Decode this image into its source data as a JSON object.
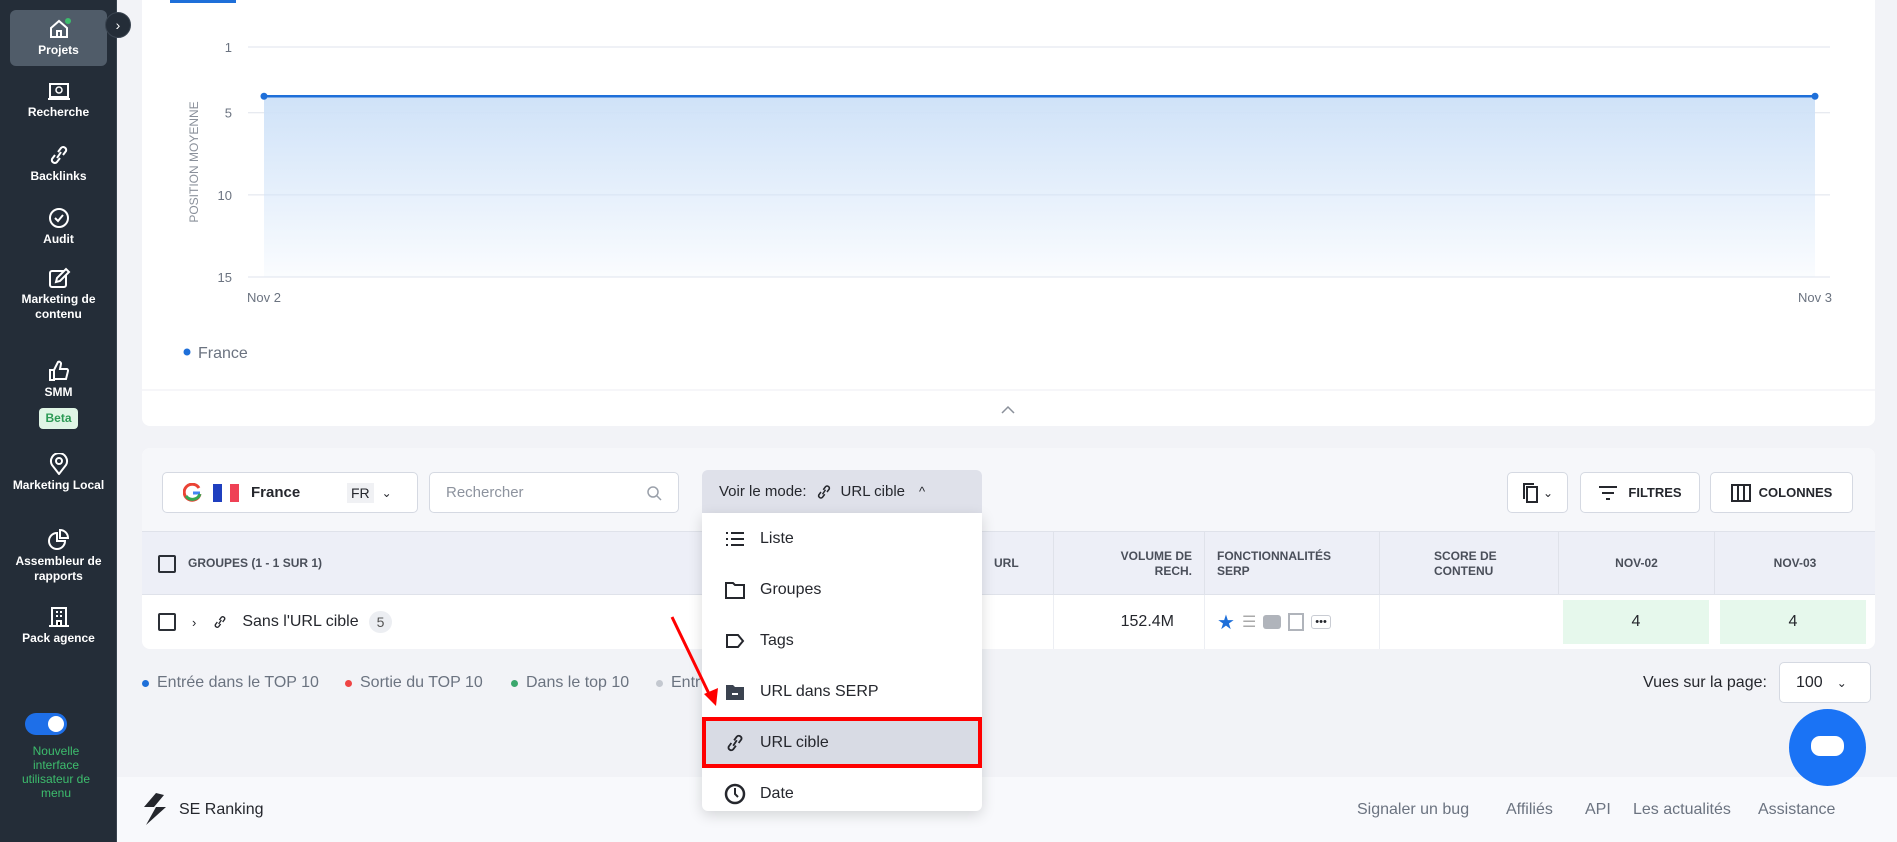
{
  "sidebar": {
    "items": [
      {
        "label": "Projets",
        "icon": "home-icon"
      },
      {
        "label": "Recherche",
        "icon": "search-screen-icon"
      },
      {
        "label": "Backlinks",
        "icon": "link-icon"
      },
      {
        "label": "Audit",
        "icon": "check-circle-icon"
      },
      {
        "label": "Marketing de contenu",
        "icon": "edit-icon"
      },
      {
        "label": "SMM",
        "icon": "thumbs-up-icon",
        "badge": "Beta"
      },
      {
        "label": "Marketing Local",
        "icon": "location-icon"
      },
      {
        "label": "Assembleur de rapports",
        "icon": "pie-chart-icon"
      },
      {
        "label": "Pack agence",
        "icon": "building-icon"
      }
    ],
    "toggle_label": "Nouvelle interface utilisateur de menu",
    "toggle_on": true
  },
  "chart_data": {
    "type": "area",
    "ylabel": "POSITION MOYENNE",
    "yticks": [
      1,
      5,
      10,
      15
    ],
    "ylim": [
      1,
      15
    ],
    "y_reversed": true,
    "xticks": [
      "Nov 2",
      "Nov 3"
    ],
    "series": [
      {
        "name": "France",
        "x": [
          "Nov 2",
          "Nov 3"
        ],
        "values": [
          4,
          4
        ],
        "color": "#1e6fd9"
      }
    ],
    "legend": "bottom-left",
    "grid": true
  },
  "toolbar": {
    "engine": "Google",
    "country": "France",
    "country_code": "FR",
    "search_placeholder": "Rechercher",
    "mode_label": "Voir le mode:",
    "mode_value": "URL cible",
    "filters": "FILTRES",
    "columns": "COLONNES"
  },
  "menu": {
    "items": [
      {
        "label": "Liste"
      },
      {
        "label": "Groupes"
      },
      {
        "label": "Tags"
      },
      {
        "label": "URL dans SERP"
      },
      {
        "label": "URL cible",
        "selected": true
      },
      {
        "label": "Date"
      }
    ]
  },
  "table": {
    "headers": {
      "groups": "GROUPES (1 - 1 SUR 1)",
      "url": "URL",
      "volume": "VOLUME DE RECH.",
      "serp": "FONCTIONNALITÉS SERP",
      "score": "SCORE DE CONTENU",
      "nov02": "NOV-02",
      "nov03": "NOV-03"
    },
    "row": {
      "name": "Sans l'URL cible",
      "count": "5",
      "volume": "152.4M",
      "nov02": "4",
      "nov03": "4"
    }
  },
  "legend": [
    {
      "label": "Entrée dans le TOP 10",
      "color": "#1e6fd9"
    },
    {
      "label": "Sortie du TOP 10",
      "color": "#ef4444"
    },
    {
      "label": "Dans le top 10",
      "color": "#3aa76d"
    },
    {
      "label": "Entr",
      "color": "#c4c8d0"
    }
  ],
  "pagination": {
    "label": "Vues sur la page:",
    "value": "100"
  },
  "footer": {
    "brand": "SE Ranking",
    "links": [
      "Signaler un bug",
      "Affiliés",
      "API",
      "Les actualités",
      "Assistance"
    ]
  }
}
